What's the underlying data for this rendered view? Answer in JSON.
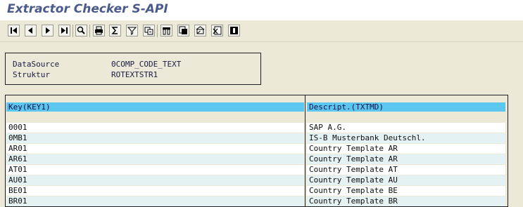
{
  "app": {
    "title": "Extractor Checker S-API"
  },
  "toolbar": {
    "buttons": [
      {
        "icon": "first-page-icon",
        "label": "First page"
      },
      {
        "icon": "previous-page-icon",
        "label": "Previous page"
      },
      {
        "icon": "next-page-icon",
        "label": "Next page"
      },
      {
        "icon": "last-page-icon",
        "label": "Last page"
      },
      {
        "icon": "find-icon",
        "label": "Find"
      },
      {
        "icon": "print-icon",
        "label": "Print"
      },
      {
        "icon": "total-icon",
        "label": "Total"
      },
      {
        "icon": "filter-icon",
        "label": "Filter"
      },
      {
        "icon": "subtotal-icon",
        "label": "Subtotal"
      },
      {
        "icon": "layout-icon",
        "label": "Change layout"
      },
      {
        "icon": "export-icon",
        "label": "Export"
      },
      {
        "icon": "send-icon",
        "label": "Send"
      },
      {
        "icon": "spreadsheet-icon",
        "label": "Spreadsheet"
      },
      {
        "icon": "details-icon",
        "label": "Details"
      }
    ]
  },
  "info": {
    "datasource_label": "DataSource",
    "datasource_value": "0COMP_CODE_TEXT",
    "struktur_label": "Struktur",
    "struktur_value": "ROTEXTSTR1"
  },
  "table": {
    "columns": [
      "Key(KEY1)",
      "Descript.(TXTMD)"
    ],
    "rows": [
      [
        "0001",
        "SAP A.G."
      ],
      [
        "0MB1",
        "IS-B Musterbank Deutschl."
      ],
      [
        "AR01",
        "Country Template AR"
      ],
      [
        "AR61",
        "Country Template AR"
      ],
      [
        "AT01",
        "Country Template AT"
      ],
      [
        "AU01",
        "Country Template AU"
      ],
      [
        "BE01",
        "Country Template BE"
      ],
      [
        "BR01",
        "Country Template BR"
      ]
    ]
  },
  "colors": {
    "header_bg": "#5bc6ef",
    "title_text": "#4a5a8c",
    "row_alt": "#e5f2f4",
    "background": "#ece9d8"
  }
}
